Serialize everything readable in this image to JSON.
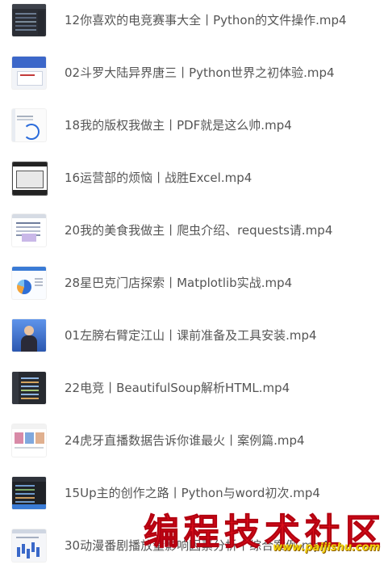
{
  "files": [
    {
      "title": "12你喜欢的电竞赛事大全丨Python的文件操作.mp4",
      "thumb": "dark"
    },
    {
      "title": "02斗罗大陆异界唐三丨Python世界之初体验.mp4",
      "thumb": "blue"
    },
    {
      "title": "18我的版权我做主丨PDF就是这么帅.mp4",
      "thumb": "doc"
    },
    {
      "title": "16运营部的烦恼丨战胜Excel.mp4",
      "thumb": "excel"
    },
    {
      "title": "20我的美食我做主丨爬虫介绍、requests请.mp4",
      "thumb": "web"
    },
    {
      "title": "28星巴克门店探索丨Matplotlib实战.mp4",
      "thumb": "chart"
    },
    {
      "title": "01左膀右臂定江山丨课前准备及工具安装.mp4",
      "thumb": "person"
    },
    {
      "title": "22电竞丨BeautifulSoup解析HTML.mp4",
      "thumb": "code"
    },
    {
      "title": "24虎牙直播数据告诉你谁最火丨案例篇.mp4",
      "thumb": "live"
    },
    {
      "title": "15Up主的创作之路丨Python与word初次.mp4",
      "thumb": "ide"
    },
    {
      "title": "30动漫番剧播放量影响因素分析丨综合案例.mp4",
      "thumb": "anime"
    }
  ],
  "watermark": {
    "text": "编程技术社区",
    "url": "www.paijishu.com",
    "color": "#e0111b"
  }
}
